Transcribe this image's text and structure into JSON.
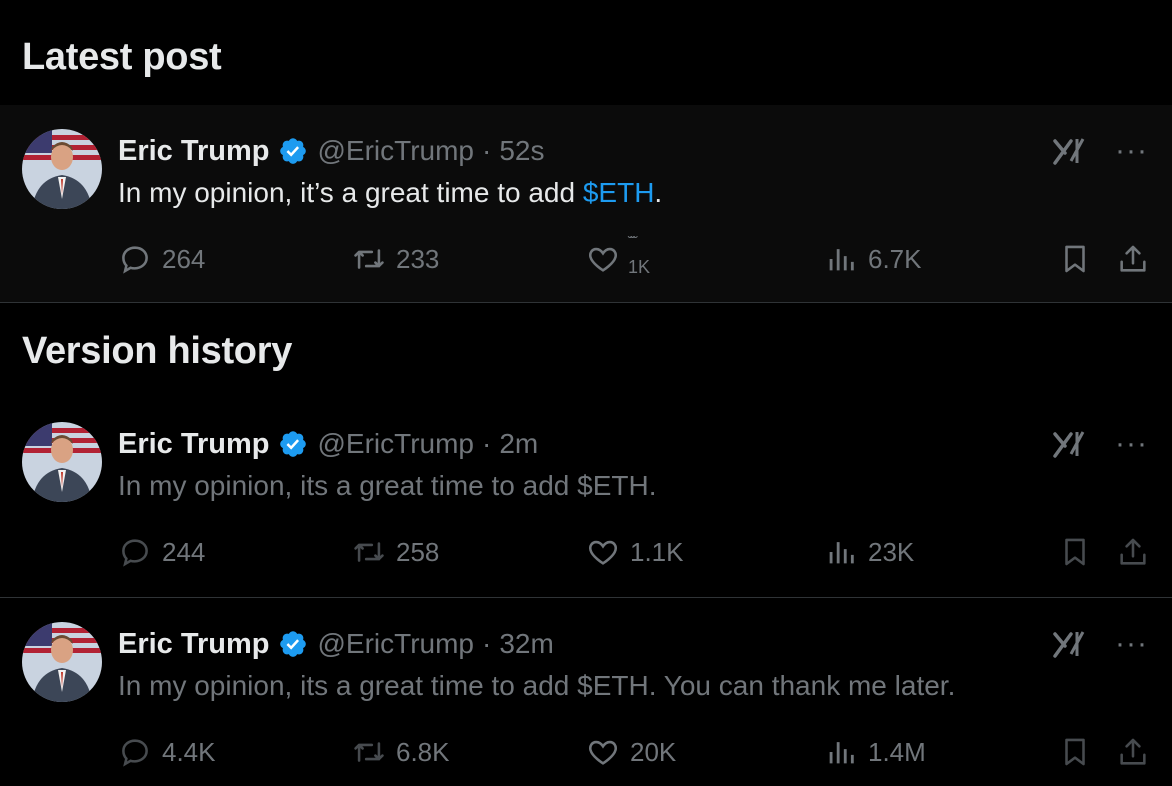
{
  "sections": {
    "latest_title": "Latest post",
    "history_title": "Version history"
  },
  "posts": [
    {
      "author": "Eric Trump",
      "handle": "@EricTrump",
      "separator": "·",
      "time": "52s",
      "text_before": "In my opinion, it’s a great time to add ",
      "cashtag": "$ETH",
      "text_after": ".",
      "replies": "264",
      "reposts": "233",
      "likes": "1K",
      "views": "6.7K"
    },
    {
      "author": "Eric Trump",
      "handle": "@EricTrump",
      "separator": "·",
      "time": "2m",
      "text": "In my opinion, its a great time to add $ETH.",
      "replies": "244",
      "reposts": "258",
      "likes": "1.1K",
      "views": "23K"
    },
    {
      "author": "Eric Trump",
      "handle": "@EricTrump",
      "separator": "·",
      "time": "32m",
      "text": "In my opinion, its a great time to add $ETH. You can thank me later.",
      "replies": "4.4K",
      "reposts": "6.8K",
      "likes": "20K",
      "views": "1.4M"
    }
  ],
  "icons": {
    "verified": "verified-badge-icon",
    "grok": "grok-icon",
    "more": "more-icon",
    "reply": "reply-icon",
    "repost": "repost-icon",
    "like": "heart-icon",
    "views": "views-icon",
    "bookmark": "bookmark-icon",
    "share": "share-icon"
  },
  "colors": {
    "background": "#000000",
    "text_primary": "#e7e9ea",
    "text_secondary": "#71767b",
    "accent": "#1d9bf0"
  }
}
